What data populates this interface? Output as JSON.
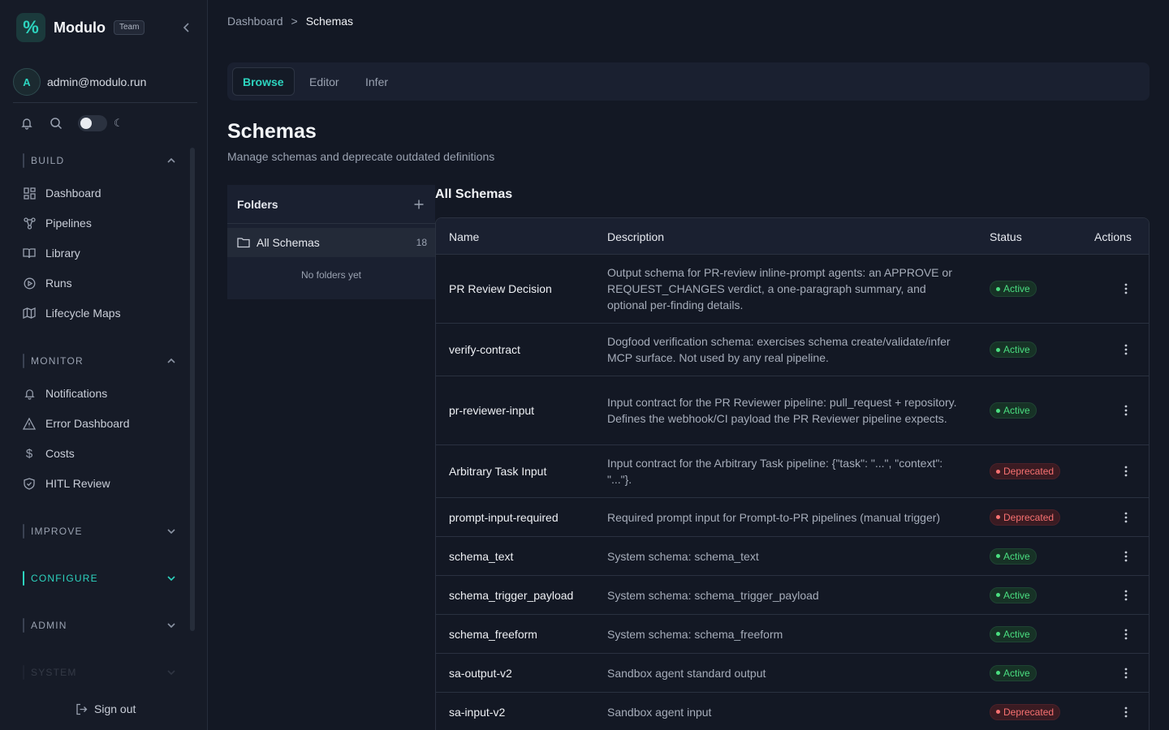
{
  "brand": {
    "logo_glyph": "%",
    "name": "Modulo",
    "badge": "Team"
  },
  "user": {
    "initial": "A",
    "email": "admin@modulo.run"
  },
  "sidebar": {
    "sections": [
      {
        "label": "BUILD",
        "expanded": true,
        "items": [
          {
            "label": "Dashboard",
            "icon": "grid-icon"
          },
          {
            "label": "Pipelines",
            "icon": "workflow-icon"
          },
          {
            "label": "Library",
            "icon": "book-icon"
          },
          {
            "label": "Runs",
            "icon": "play-circle-icon"
          },
          {
            "label": "Lifecycle Maps",
            "icon": "map-icon"
          }
        ]
      },
      {
        "label": "MONITOR",
        "expanded": true,
        "items": [
          {
            "label": "Notifications",
            "icon": "bell-icon"
          },
          {
            "label": "Error Dashboard",
            "icon": "warning-icon"
          },
          {
            "label": "Costs",
            "icon": "dollar-icon"
          },
          {
            "label": "HITL Review",
            "icon": "shield-icon"
          }
        ]
      },
      {
        "label": "IMPROVE",
        "expanded": false
      },
      {
        "label": "CONFIGURE",
        "expanded": false,
        "active": true
      },
      {
        "label": "ADMIN",
        "expanded": false
      },
      {
        "label": "SYSTEM",
        "expanded": false
      }
    ],
    "signout_label": "Sign out"
  },
  "breadcrumb": {
    "root": "Dashboard",
    "separator": ">",
    "current": "Schemas"
  },
  "tabs": [
    {
      "label": "Browse",
      "active": true
    },
    {
      "label": "Editor",
      "active": false
    },
    {
      "label": "Infer",
      "active": false
    }
  ],
  "page": {
    "title": "Schemas",
    "subtitle": "Manage schemas and deprecate outdated definitions"
  },
  "folders": {
    "title": "Folders",
    "all": {
      "label": "All Schemas",
      "count": "18"
    },
    "empty_text": "No folders yet"
  },
  "schemas": {
    "title": "All Schemas",
    "columns": {
      "name": "Name",
      "description": "Description",
      "status": "Status",
      "actions": "Actions"
    },
    "rows": [
      {
        "name": "PR Review Decision",
        "description": "Output schema for PR-review inline-prompt agents: an APPROVE or REQUEST_CHANGES verdict, a one-paragraph summary, and optional per-finding details.",
        "status": "Active"
      },
      {
        "name": "verify-contract",
        "description": "Dogfood verification schema: exercises schema create/validate/infer MCP surface. Not used by any real pipeline.",
        "status": "Active"
      },
      {
        "name": "pr-reviewer-input",
        "description": "Input contract for the PR Reviewer pipeline: pull_request + repository. Defines the webhook/CI payload the PR Reviewer pipeline expects.",
        "status": "Active"
      },
      {
        "name": "Arbitrary Task Input",
        "description": "Input contract for the Arbitrary Task pipeline: {\"task\": \"...\", \"context\": \"...\"}.",
        "status": "Deprecated"
      },
      {
        "name": "prompt-input-required",
        "description": "Required prompt input for Prompt-to-PR pipelines (manual trigger)",
        "status": "Deprecated"
      },
      {
        "name": "schema_text",
        "description": "System schema: schema_text",
        "status": "Active"
      },
      {
        "name": "schema_trigger_payload",
        "description": "System schema: schema_trigger_payload",
        "status": "Active"
      },
      {
        "name": "schema_freeform",
        "description": "System schema: schema_freeform",
        "status": "Active"
      },
      {
        "name": "sa-output-v2",
        "description": "Sandbox agent standard output",
        "status": "Active"
      },
      {
        "name": "sa-input-v2",
        "description": "Sandbox agent input",
        "status": "Deprecated"
      }
    ]
  },
  "colors": {
    "accent": "#2dd4bf",
    "active": "#4ade80",
    "deprecated": "#f87171",
    "background": "#131824"
  }
}
